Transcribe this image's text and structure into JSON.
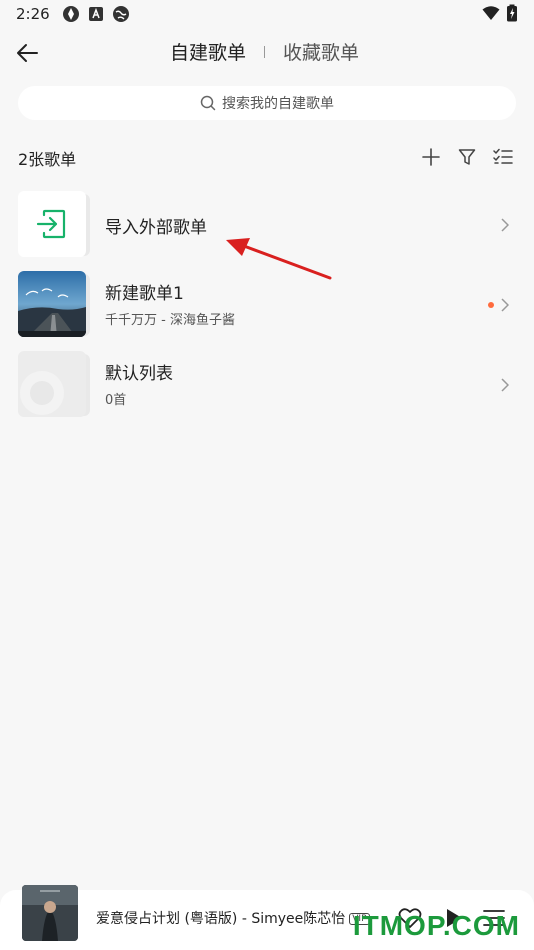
{
  "status": {
    "time": "2:26"
  },
  "header": {
    "tab_active": "自建歌单",
    "tab_inactive": "收藏歌单"
  },
  "search": {
    "placeholder": "搜索我的自建歌单"
  },
  "list": {
    "count_label": "2张歌单",
    "items": [
      {
        "title": "导入外部歌单",
        "subtitle": ""
      },
      {
        "title": "新建歌单1",
        "subtitle": "千千万万 - 深海鱼子酱"
      },
      {
        "title": "默认列表",
        "subtitle": "0首"
      }
    ]
  },
  "player": {
    "title": "爱意侵占计划 (粤语版) - Simyee陈芯怡",
    "vip": "VIP"
  },
  "watermark": "ITMOP.COM",
  "colors": {
    "accent_green": "#17b26a",
    "dot_orange": "#ff6b3d",
    "annotation_red": "#d9201f"
  }
}
